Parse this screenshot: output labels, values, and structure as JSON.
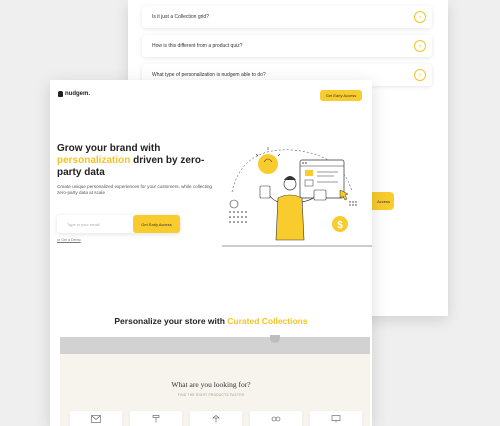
{
  "faq": {
    "items": [
      {
        "question": "Is it just a Collection grid?"
      },
      {
        "question": "How is this different from a product quiz?"
      },
      {
        "question": "What type of personalization is nudgem able to do?"
      }
    ]
  },
  "back_page": {
    "cta_label": "Access"
  },
  "brand": {
    "name": "nudgem."
  },
  "nav": {
    "cta_label": "Get Early Access"
  },
  "hero": {
    "title_line1": "Grow your brand with",
    "title_highlight": "personalization",
    "title_rest": "driven by zero-party data",
    "subtitle": "Create unique personalized experiences for your customers, while collecting zero-party data at scale",
    "email_placeholder": "Type in your email",
    "early_access_label": "Get Early Access",
    "demo_link": "or Get a Demo"
  },
  "section": {
    "title_prefix": "Personalize your store with",
    "title_highlight": "Curated Collections"
  },
  "lower": {
    "heading": "What are you looking for?",
    "subheading": "FIND THE RIGHT PRODUCTS FASTER",
    "categories": [
      {
        "icon": "envelope-icon"
      },
      {
        "icon": "stool-icon"
      },
      {
        "icon": "lamp-icon"
      },
      {
        "icon": "bow-icon"
      },
      {
        "icon": "monitor-icon"
      }
    ]
  },
  "colors": {
    "accent": "#f9cc2d",
    "highlight_text": "#f3c324",
    "background": "#efefef"
  }
}
